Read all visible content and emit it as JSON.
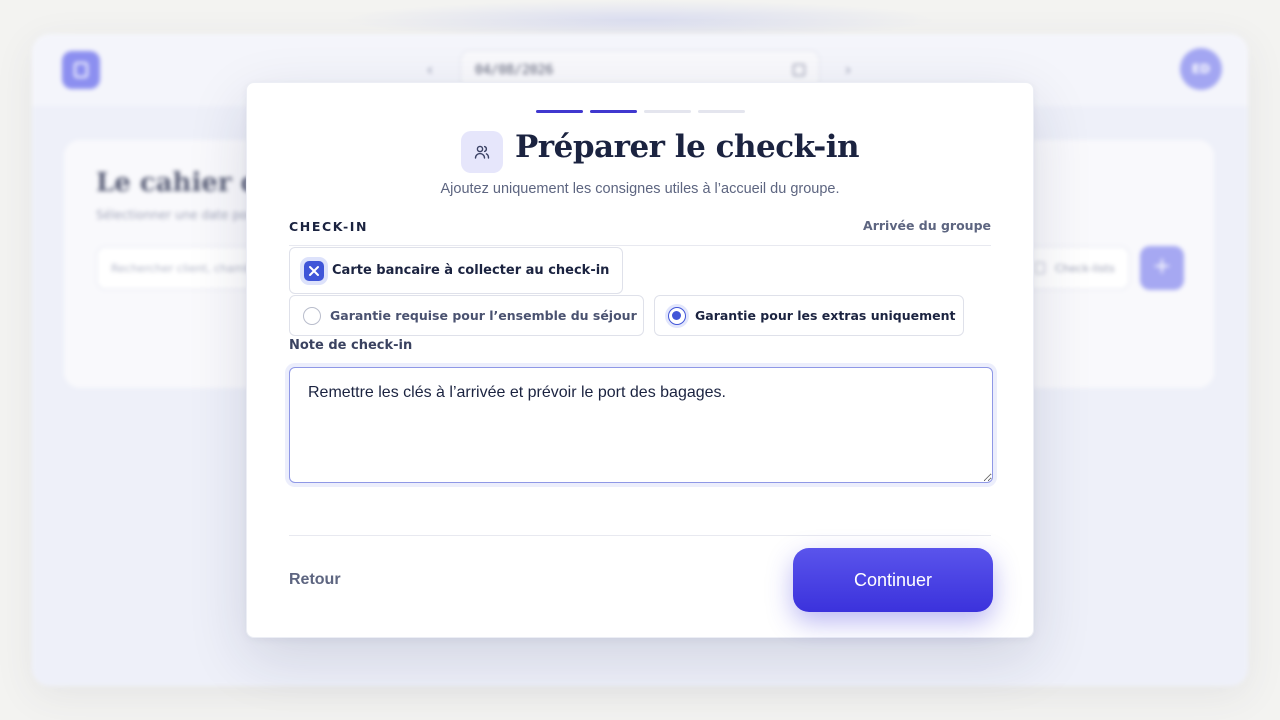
{
  "background": {
    "date_value": "04/08/2026",
    "nav_prev": "‹",
    "nav_next": "›",
    "avatar_initials": "ED",
    "card_title": "Le cahier de consignes",
    "card_subtitle": "Sélectionner une date pour afficher les consignes",
    "search_placeholder": "Rechercher client, chambre…",
    "checklist_label": "Check-lists",
    "add_label": "+"
  },
  "modal": {
    "steps": [
      {
        "state": "done"
      },
      {
        "state": "active"
      },
      {
        "state": "todo"
      },
      {
        "state": "todo"
      }
    ],
    "title": "Préparer le check-in",
    "subtitle": "Ajoutez uniquement les consignes utiles à l’accueil du groupe.",
    "section_label": "CHECK-IN",
    "section_context": "Arrivée du groupe",
    "chip": {
      "label": "Carte bancaire à collecter au check-in",
      "icon": "close-icon"
    },
    "radio_options": [
      {
        "label": "Garantie requise pour l’ensemble du séjour",
        "checked": false
      },
      {
        "label": "Garantie pour les extras uniquement",
        "checked": true
      }
    ],
    "note_label": "Note de check-in",
    "note_value": "Remettre les clés à l’arrivée et prévoir le port des bagages.",
    "back_label": "Retour",
    "continue_label": "Continuer"
  },
  "colors": {
    "accent": "#4038cf",
    "accent_button": "#3b32dc",
    "text_primary": "#1b2340",
    "text_muted": "#5d6580"
  }
}
